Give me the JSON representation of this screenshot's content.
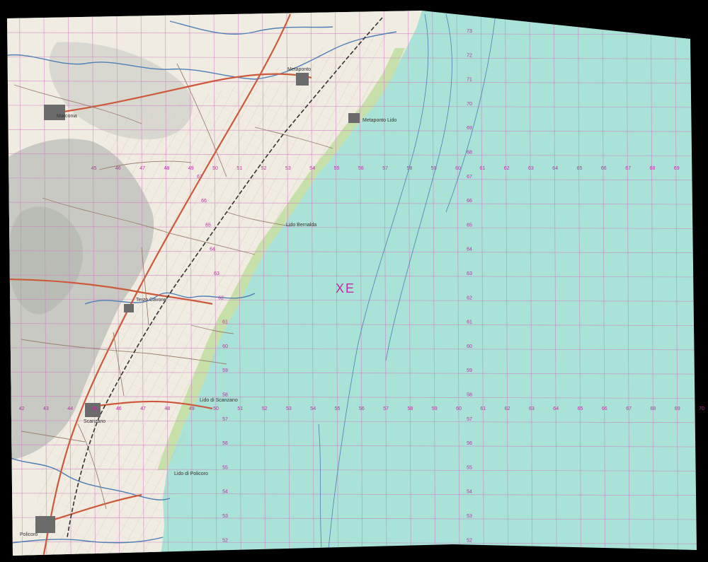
{
  "map": {
    "zone_label": "XE",
    "colors": {
      "sea": "#a9e2d6",
      "land": "#f1ece1",
      "relief": "#b9bdb7",
      "beach": "#c7dfa8",
      "grid": "#cf7fc4",
      "grid_label": "#c02aa6",
      "road_main": "#cc5a3a",
      "road_minor": "#9a7f6e",
      "river": "#4d7fb8",
      "railway": "#333333",
      "town": "#6b6b6b"
    },
    "sea_eastings": [
      "50",
      "51",
      "52",
      "53",
      "54",
      "55",
      "56",
      "57",
      "58",
      "59",
      "60",
      "61",
      "62",
      "63",
      "64",
      "65",
      "66",
      "67",
      "68",
      "69",
      "70"
    ],
    "northings": [
      "73",
      "72",
      "71",
      "70",
      "69",
      "68",
      "67",
      "66",
      "65",
      "64",
      "63",
      "62",
      "61",
      "60",
      "59",
      "58",
      "57",
      "56",
      "55",
      "54",
      "53",
      "52"
    ],
    "row_upper_eastings": [
      "45",
      "46",
      "47",
      "48",
      "49",
      "50",
      "51",
      "52",
      "53",
      "54",
      "55",
      "56",
      "57",
      "58",
      "59",
      "60",
      "61",
      "62",
      "63",
      "64",
      "65",
      "66",
      "67",
      "68",
      "69"
    ],
    "row_lower_eastings": [
      "42",
      "43",
      "44",
      "45",
      "46",
      "47",
      "48",
      "49",
      "50",
      "51",
      "52",
      "53",
      "54",
      "55",
      "56",
      "57",
      "58",
      "59",
      "60",
      "61",
      "62",
      "63",
      "64",
      "65",
      "66",
      "67",
      "68",
      "69",
      "70"
    ],
    "place_names": {
      "metaponto": "Metaponto",
      "metaponto_lido": "Metaponto Lido",
      "marconia": "Marconia",
      "scanzano": "Scanzano",
      "policoro": "Policoro",
      "lido_scanzano": "Lido di Scanzano",
      "terzo_cavone": "Terzo Cavone",
      "lido_bernalda": "Lido Bernalda",
      "lido_policoro": "Lido di Policoro"
    }
  }
}
